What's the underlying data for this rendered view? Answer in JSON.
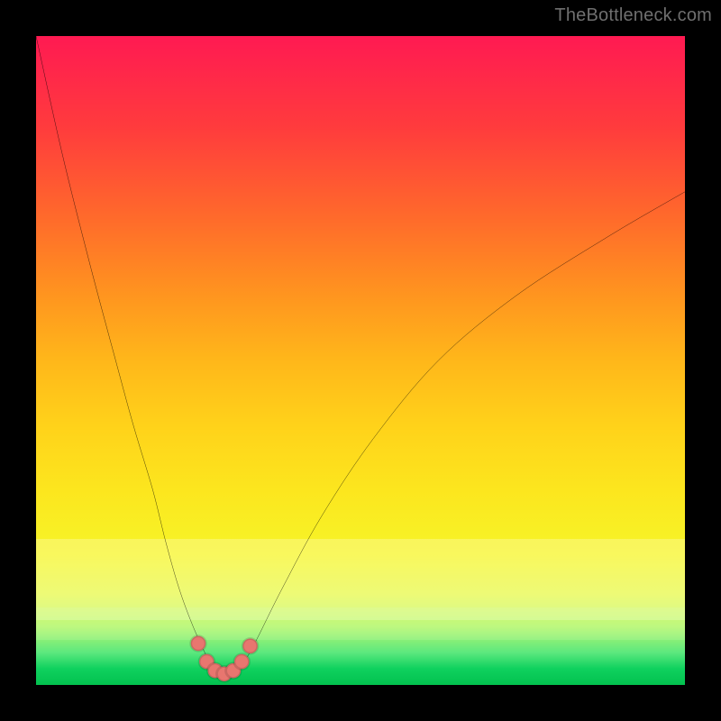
{
  "watermark": "TheBottleneck.com",
  "chart_data": {
    "type": "line",
    "title": "",
    "xlabel": "",
    "ylabel": "",
    "xlim": [
      0,
      100
    ],
    "ylim": [
      0,
      100
    ],
    "grid": false,
    "legend": false,
    "background_gradient": {
      "direction": "vertical",
      "stops": [
        {
          "pos": 0,
          "color": "#ff1a52"
        },
        {
          "pos": 28,
          "color": "#ff6a2b"
        },
        {
          "pos": 50,
          "color": "#ffb71a"
        },
        {
          "pos": 70,
          "color": "#fce61e"
        },
        {
          "pos": 90,
          "color": "#b7f770"
        },
        {
          "pos": 100,
          "color": "#03c14f"
        }
      ]
    },
    "series": [
      {
        "name": "bottleneck-curve",
        "color": "#000000",
        "x": [
          0,
          4,
          8,
          12,
          15,
          18,
          20,
          22,
          24,
          26,
          27,
          28,
          29,
          30,
          31,
          32,
          34,
          38,
          44,
          52,
          62,
          74,
          88,
          100
        ],
        "y": [
          100,
          82,
          66,
          51,
          40,
          30,
          22,
          15,
          9.5,
          5,
          3.2,
          2.2,
          1.7,
          1.7,
          2.2,
          3.4,
          7,
          15,
          26,
          38,
          50,
          60,
          69,
          76
        ]
      }
    ],
    "markers": {
      "name": "trough-dots",
      "color": "#e8766f",
      "points": [
        {
          "x": 25.0,
          "y": 6.4
        },
        {
          "x": 26.3,
          "y": 3.6
        },
        {
          "x": 27.6,
          "y": 2.2
        },
        {
          "x": 29.0,
          "y": 1.7
        },
        {
          "x": 30.4,
          "y": 2.2
        },
        {
          "x": 31.7,
          "y": 3.6
        },
        {
          "x": 33.0,
          "y": 6.0
        }
      ]
    }
  }
}
